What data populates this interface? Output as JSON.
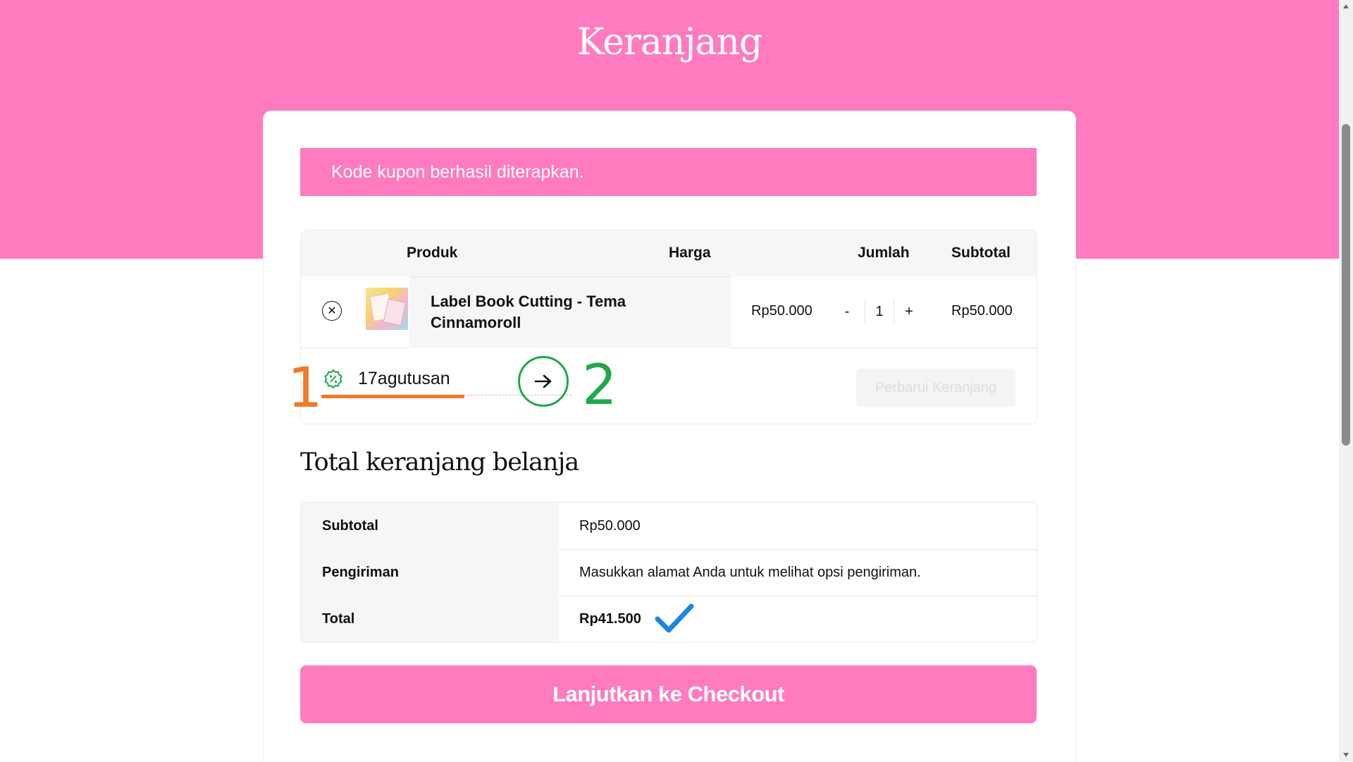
{
  "page": {
    "title": "Keranjang"
  },
  "notice": {
    "message": "Kode kupon berhasil diterapkan."
  },
  "cart": {
    "headers": {
      "product": "Produk",
      "price": "Harga",
      "quantity": "Jumlah",
      "subtotal": "Subtotal"
    },
    "items": [
      {
        "name": "Label Book Cutting - Tema Cinnamoroll",
        "price": "Rp50.000",
        "quantity": "1",
        "subtotal": "Rp50.000",
        "remove_icon": "close-circle-icon",
        "thumbnail_icon": "product-thumbnail"
      }
    ],
    "qty_minus": "-",
    "qty_plus": "+",
    "coupon": {
      "value": "17agutusan",
      "icon": "discount-badge-icon",
      "apply_icon": "arrow-right-icon"
    },
    "update_button": "Perbarui Keranjang"
  },
  "annotations": {
    "marker_1": "1",
    "marker_2": "2",
    "marker_1_color": "#f07a27",
    "marker_2_color": "#1fa84a",
    "check_color": "#1a87e6"
  },
  "totals": {
    "title": "Total keranjang belanja",
    "rows": [
      {
        "label": "Subtotal",
        "value": "Rp50.000"
      },
      {
        "label": "Pengiriman",
        "value": "Masukkan alamat Anda untuk melihat opsi pengiriman."
      },
      {
        "label": "Total",
        "value": "Rp41.500"
      }
    ]
  },
  "checkout_button": "Lanjutkan ke Checkout",
  "colors": {
    "brand_pink": "#ff7abf",
    "text": "#111111",
    "table_header_bg": "#f6f6f6"
  }
}
